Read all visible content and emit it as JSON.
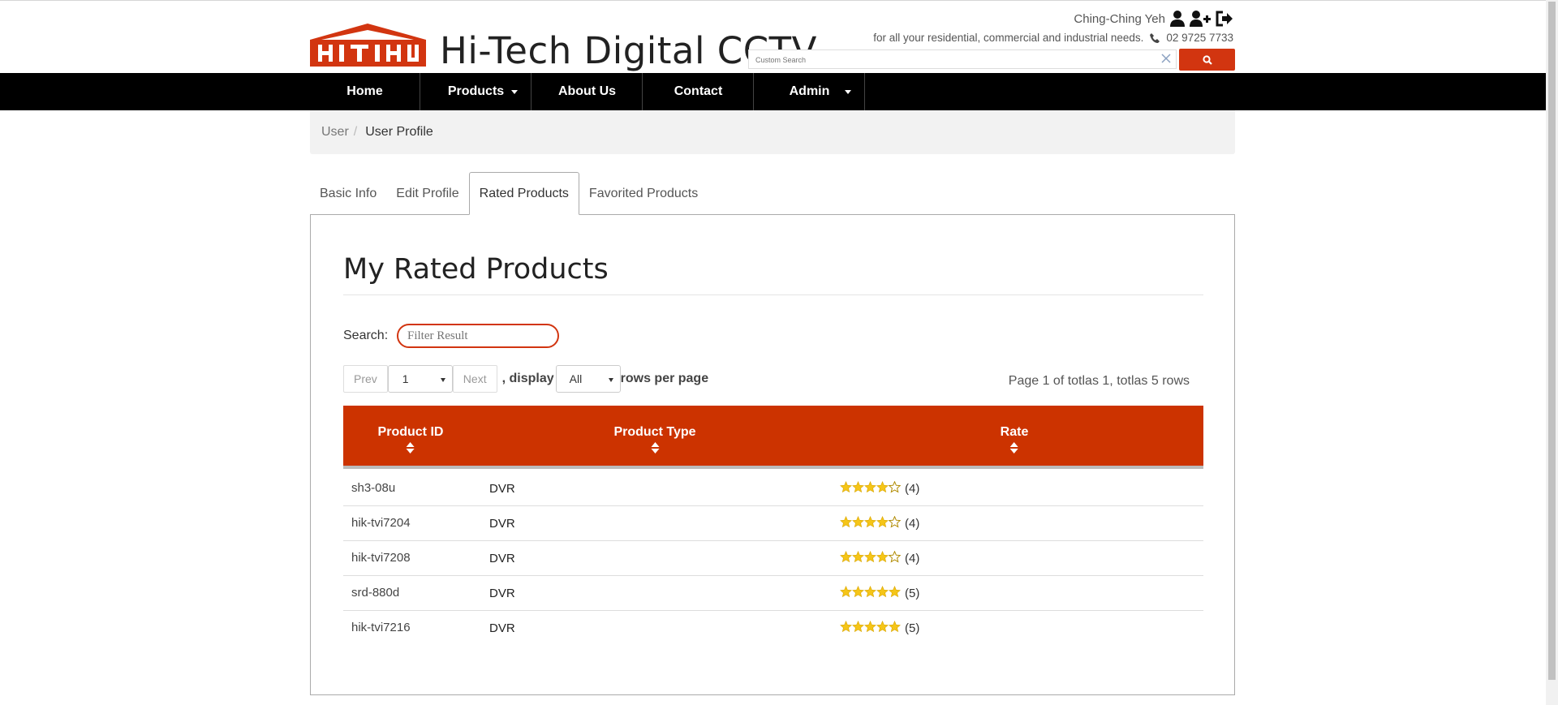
{
  "header": {
    "site_title": "Hi-Tech Digital CCTV",
    "user_name": "Ching-Ching Yeh",
    "tagline": "for all your residential, commercial and industrial needs.",
    "phone": "02 9725 7733",
    "search_placeholder": "Custom Search",
    "brand_color": "#d23510"
  },
  "nav": {
    "items": [
      {
        "label": "Home"
      },
      {
        "label": "Products"
      },
      {
        "label": "About Us"
      },
      {
        "label": "Contact"
      },
      {
        "label": "Admin"
      }
    ]
  },
  "breadcrumb": {
    "items": [
      {
        "label": "User"
      },
      {
        "label": "User Profile"
      }
    ]
  },
  "tabs": [
    {
      "label": "Basic Info"
    },
    {
      "label": "Edit Profile"
    },
    {
      "label": "Rated Products",
      "active": true
    },
    {
      "label": "Favorited Products"
    }
  ],
  "main": {
    "title": "My Rated Products",
    "search_label": "Search:",
    "filter_placeholder": "Filter Result",
    "pager": {
      "prev": "Prev",
      "page": "1",
      "next": "Next",
      "display_label": ", display",
      "per_page_value": "All",
      "rows_label": "rows per page",
      "info": "Page 1 of totlas 1, totlas 5 rows"
    },
    "table": {
      "columns": [
        "Product ID",
        "Product Type",
        "Rate"
      ],
      "rows": [
        {
          "id": "sh3-08u",
          "type": "DVR",
          "rating": 4,
          "rating_label": "(4)"
        },
        {
          "id": "hik-tvi7204",
          "type": "DVR",
          "rating": 4,
          "rating_label": "(4)"
        },
        {
          "id": "hik-tvi7208",
          "type": "DVR",
          "rating": 4,
          "rating_label": "(4)"
        },
        {
          "id": "srd-880d",
          "type": "DVR",
          "rating": 5,
          "rating_label": "(5)"
        },
        {
          "id": "hik-tvi7216",
          "type": "DVR",
          "rating": 5,
          "rating_label": "(5)"
        }
      ]
    }
  },
  "colors": {
    "table_header": "#cc3300",
    "star_fill": "#f5c518",
    "navbar": "#000000"
  }
}
